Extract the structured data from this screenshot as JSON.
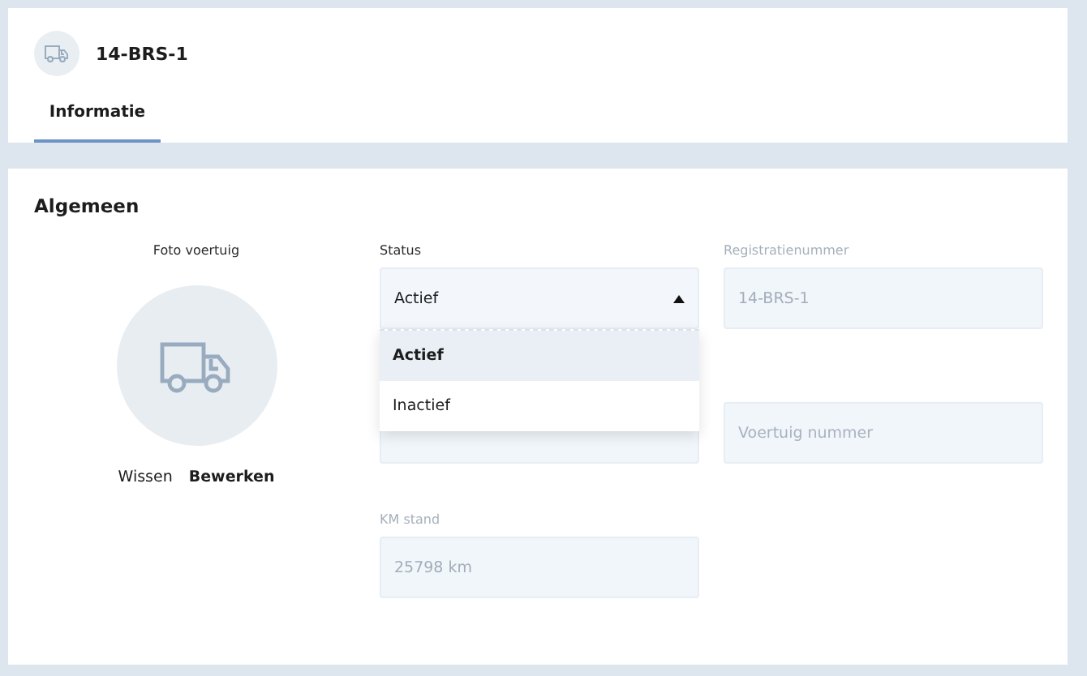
{
  "header": {
    "title": "14-BRS-1",
    "tabs": [
      {
        "label": "Informatie",
        "selected": true
      }
    ]
  },
  "section": {
    "title": "Algemeen",
    "photo": {
      "label": "Foto voertuig",
      "actions": [
        {
          "label": "Wissen",
          "kind": "secondary"
        },
        {
          "label": "Bewerken",
          "kind": "primary"
        }
      ]
    },
    "fields": [
      {
        "kind": "select",
        "label": "Status",
        "value": "Actief",
        "disabled": false,
        "expanded": true,
        "options": [
          {
            "label": "Actief",
            "selected": true
          },
          {
            "label": "Inactief",
            "selected": false
          }
        ]
      },
      {
        "kind": "text",
        "label": "Registratienummer",
        "value": "14-BRS-1",
        "disabled": true
      },
      {
        "kind": "text"
      },
      {
        "kind": "text",
        "placeholder": "Voertuig nummer"
      },
      {
        "kind": "text",
        "label": "KM stand",
        "value": "25798 km",
        "disabled": true
      }
    ]
  }
}
